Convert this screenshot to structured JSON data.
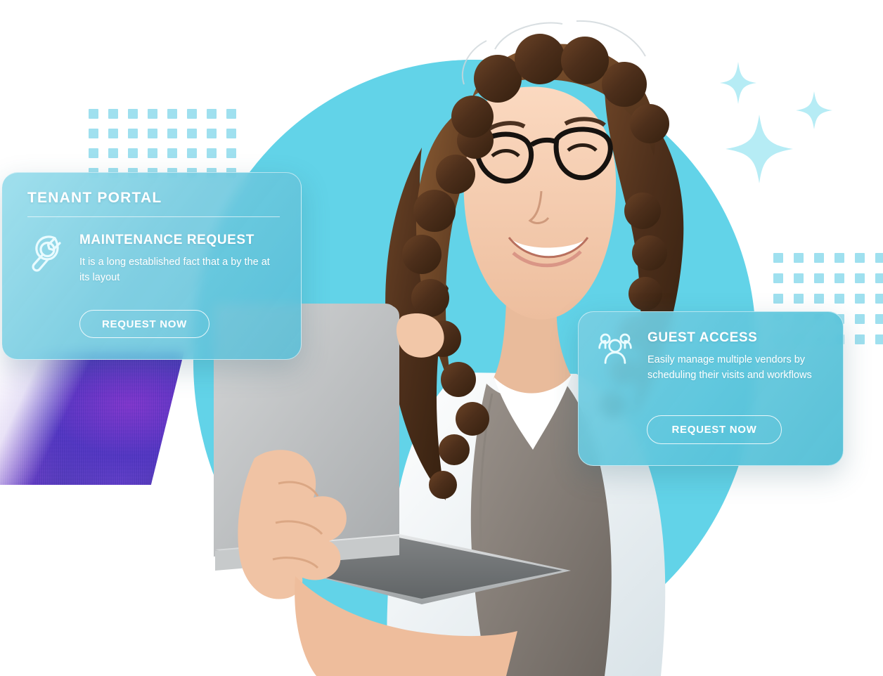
{
  "hero": {
    "circle_color": "#62d3e8",
    "photo_alt": "smiling woman with curly hair and glasses holding an open laptop"
  },
  "decor": {
    "dot_color": "#9fe0ef",
    "sparkle_color": "#b6ecf5",
    "dots_left_label": "dot-grid-top-left",
    "dots_right_label": "dot-grid-right",
    "sparkles": [
      "sparkle-small-top",
      "sparkle-small-right",
      "sparkle-large"
    ]
  },
  "cards": [
    {
      "id": "tenant-portal",
      "eyebrow": "TENANT PORTAL",
      "icon": "wrench-icon",
      "title": "MAINTENANCE REQUEST",
      "description": "It is a long established fact that a by the at its layout",
      "cta": "REQUEST NOW"
    },
    {
      "id": "guest-access",
      "eyebrow": "",
      "icon": "users-group-icon",
      "title": "GUEST ACCESS",
      "description": "Easily manage multiple vendors by scheduling their visits and workflows",
      "cta": "REQUEST NOW"
    }
  ]
}
